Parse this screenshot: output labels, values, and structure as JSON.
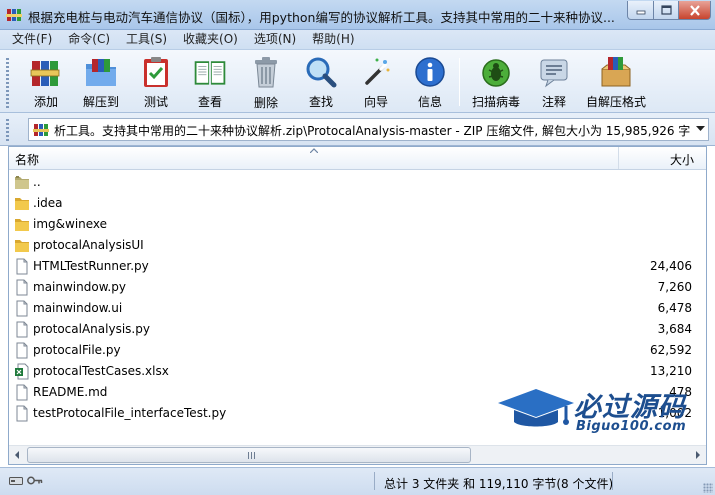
{
  "window": {
    "title": "根据充电桩与电动汽车通信协议（国标），用python编写的协议解析工具。支持其中常用的二十来种协议..."
  },
  "menu": [
    {
      "label": "文件(F)"
    },
    {
      "label": "命令(C)"
    },
    {
      "label": "工具(S)"
    },
    {
      "label": "收藏夹(O)"
    },
    {
      "label": "选项(N)"
    },
    {
      "label": "帮助(H)"
    }
  ],
  "toolbar": {
    "buttons": [
      {
        "label": "添加",
        "icon": "add-books-icon"
      },
      {
        "label": "解压到",
        "icon": "extract-folder-icon"
      },
      {
        "label": "测试",
        "icon": "test-clipboard-icon"
      },
      {
        "label": "查看",
        "icon": "view-book-icon"
      },
      {
        "label": "删除",
        "icon": "delete-trash-icon"
      },
      {
        "label": "查找",
        "icon": "find-magnifier-icon"
      },
      {
        "label": "向导",
        "icon": "wizard-wand-icon"
      },
      {
        "label": "信息",
        "icon": "info-icon"
      },
      {
        "label": "扫描病毒",
        "icon": "virus-scan-icon"
      },
      {
        "label": "注释",
        "icon": "comment-icon"
      },
      {
        "label": "自解压格式",
        "icon": "sfx-box-icon"
      }
    ]
  },
  "address": {
    "path": "析工具。支持其中常用的二十来种协议解析.zip\\ProtocalAnalysis-master - ZIP 压缩文件, 解包大小为 15,985,926 字节"
  },
  "columns": {
    "name": "名称",
    "size": "大小"
  },
  "files": [
    {
      "name": "..",
      "size": "",
      "type": "parent"
    },
    {
      "name": ".idea",
      "size": "",
      "type": "folder"
    },
    {
      "name": "img&winexe",
      "size": "",
      "type": "folder"
    },
    {
      "name": "protocalAnalysisUI",
      "size": "",
      "type": "folder"
    },
    {
      "name": "HTMLTestRunner.py",
      "size": "24,406",
      "type": "file"
    },
    {
      "name": "mainwindow.py",
      "size": "7,260",
      "type": "file"
    },
    {
      "name": "mainwindow.ui",
      "size": "6,478",
      "type": "file"
    },
    {
      "name": "protocalAnalysis.py",
      "size": "3,684",
      "type": "file"
    },
    {
      "name": "protocalFile.py",
      "size": "62,592",
      "type": "file"
    },
    {
      "name": "protocalTestCases.xlsx",
      "size": "13,210",
      "type": "excel"
    },
    {
      "name": "README.md",
      "size": "478",
      "type": "file"
    },
    {
      "name": "testProtocalFile_interfaceTest.py",
      "size": "1,002",
      "type": "file"
    }
  ],
  "status": {
    "summary": "总计 3 文件夹 和 119,110 字节(8 个文件)"
  },
  "watermark": {
    "title": "必过源码",
    "subtitle": "Biguo100.com"
  }
}
